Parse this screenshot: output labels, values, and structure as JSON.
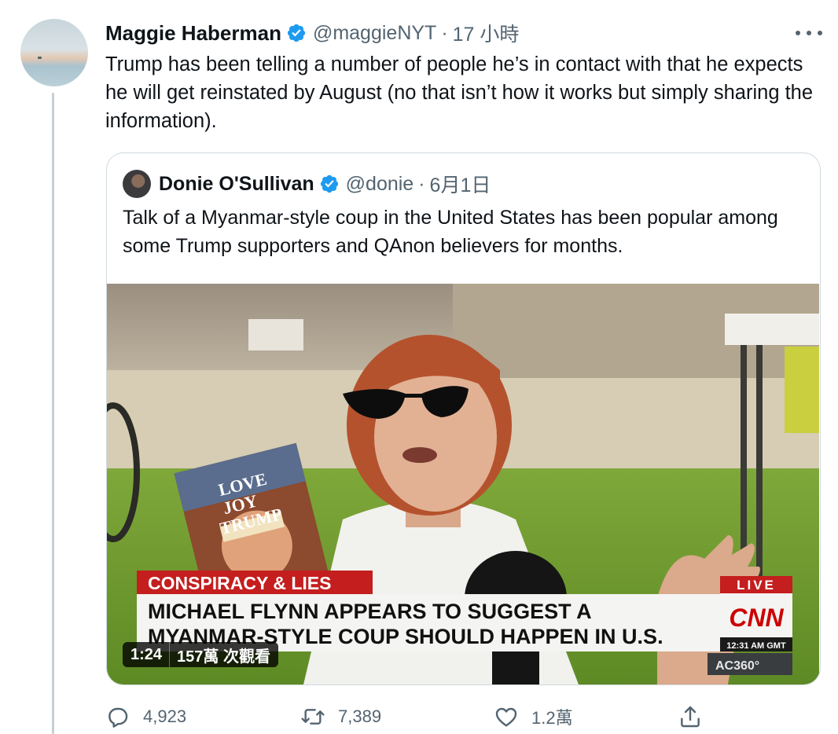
{
  "tweet": {
    "author_name": "Maggie Haberman",
    "handle": "@maggieNYT",
    "separator": "·",
    "time": "17 小時",
    "text": "Trump has been telling a number of people he’s in contact with that he expects he will get reinstated by August (no that isn’t how it works but simply sharing the information).",
    "icons": {
      "verified": "verified-badge-icon",
      "more": "more-options-icon"
    },
    "accent_color": "#1d9bf0"
  },
  "quoted_tweet": {
    "author_name": "Donie O'Sullivan",
    "handle": "@donie",
    "separator": "·",
    "time": "6月1日",
    "text": "Talk of a Myanmar-style coup in the United States has been popular among some Trump supporters and QAnon believers for months.",
    "video": {
      "duration": "1:24",
      "views": "157萬 次觀看",
      "chyron_kicker": "CONSPIRACY & LIES",
      "chyron_line1": "MICHAEL FLYNN APPEARS TO SUGGEST A",
      "chyron_line2": "MYANMAR-STYLE COUP SHOULD HAPPEN IN U.S.",
      "live_label": "LIVE",
      "network": "CNN",
      "clock": "12:31 AM GMT",
      "show": "AC360°",
      "sign_text": [
        "LOVE",
        "JOY",
        "TRUMP"
      ]
    }
  },
  "actions": {
    "reply_count": "4,923",
    "retweet_count": "7,389",
    "like_count": "1.2萬",
    "icons": [
      "reply-icon",
      "retweet-icon",
      "like-icon",
      "share-icon"
    ]
  }
}
